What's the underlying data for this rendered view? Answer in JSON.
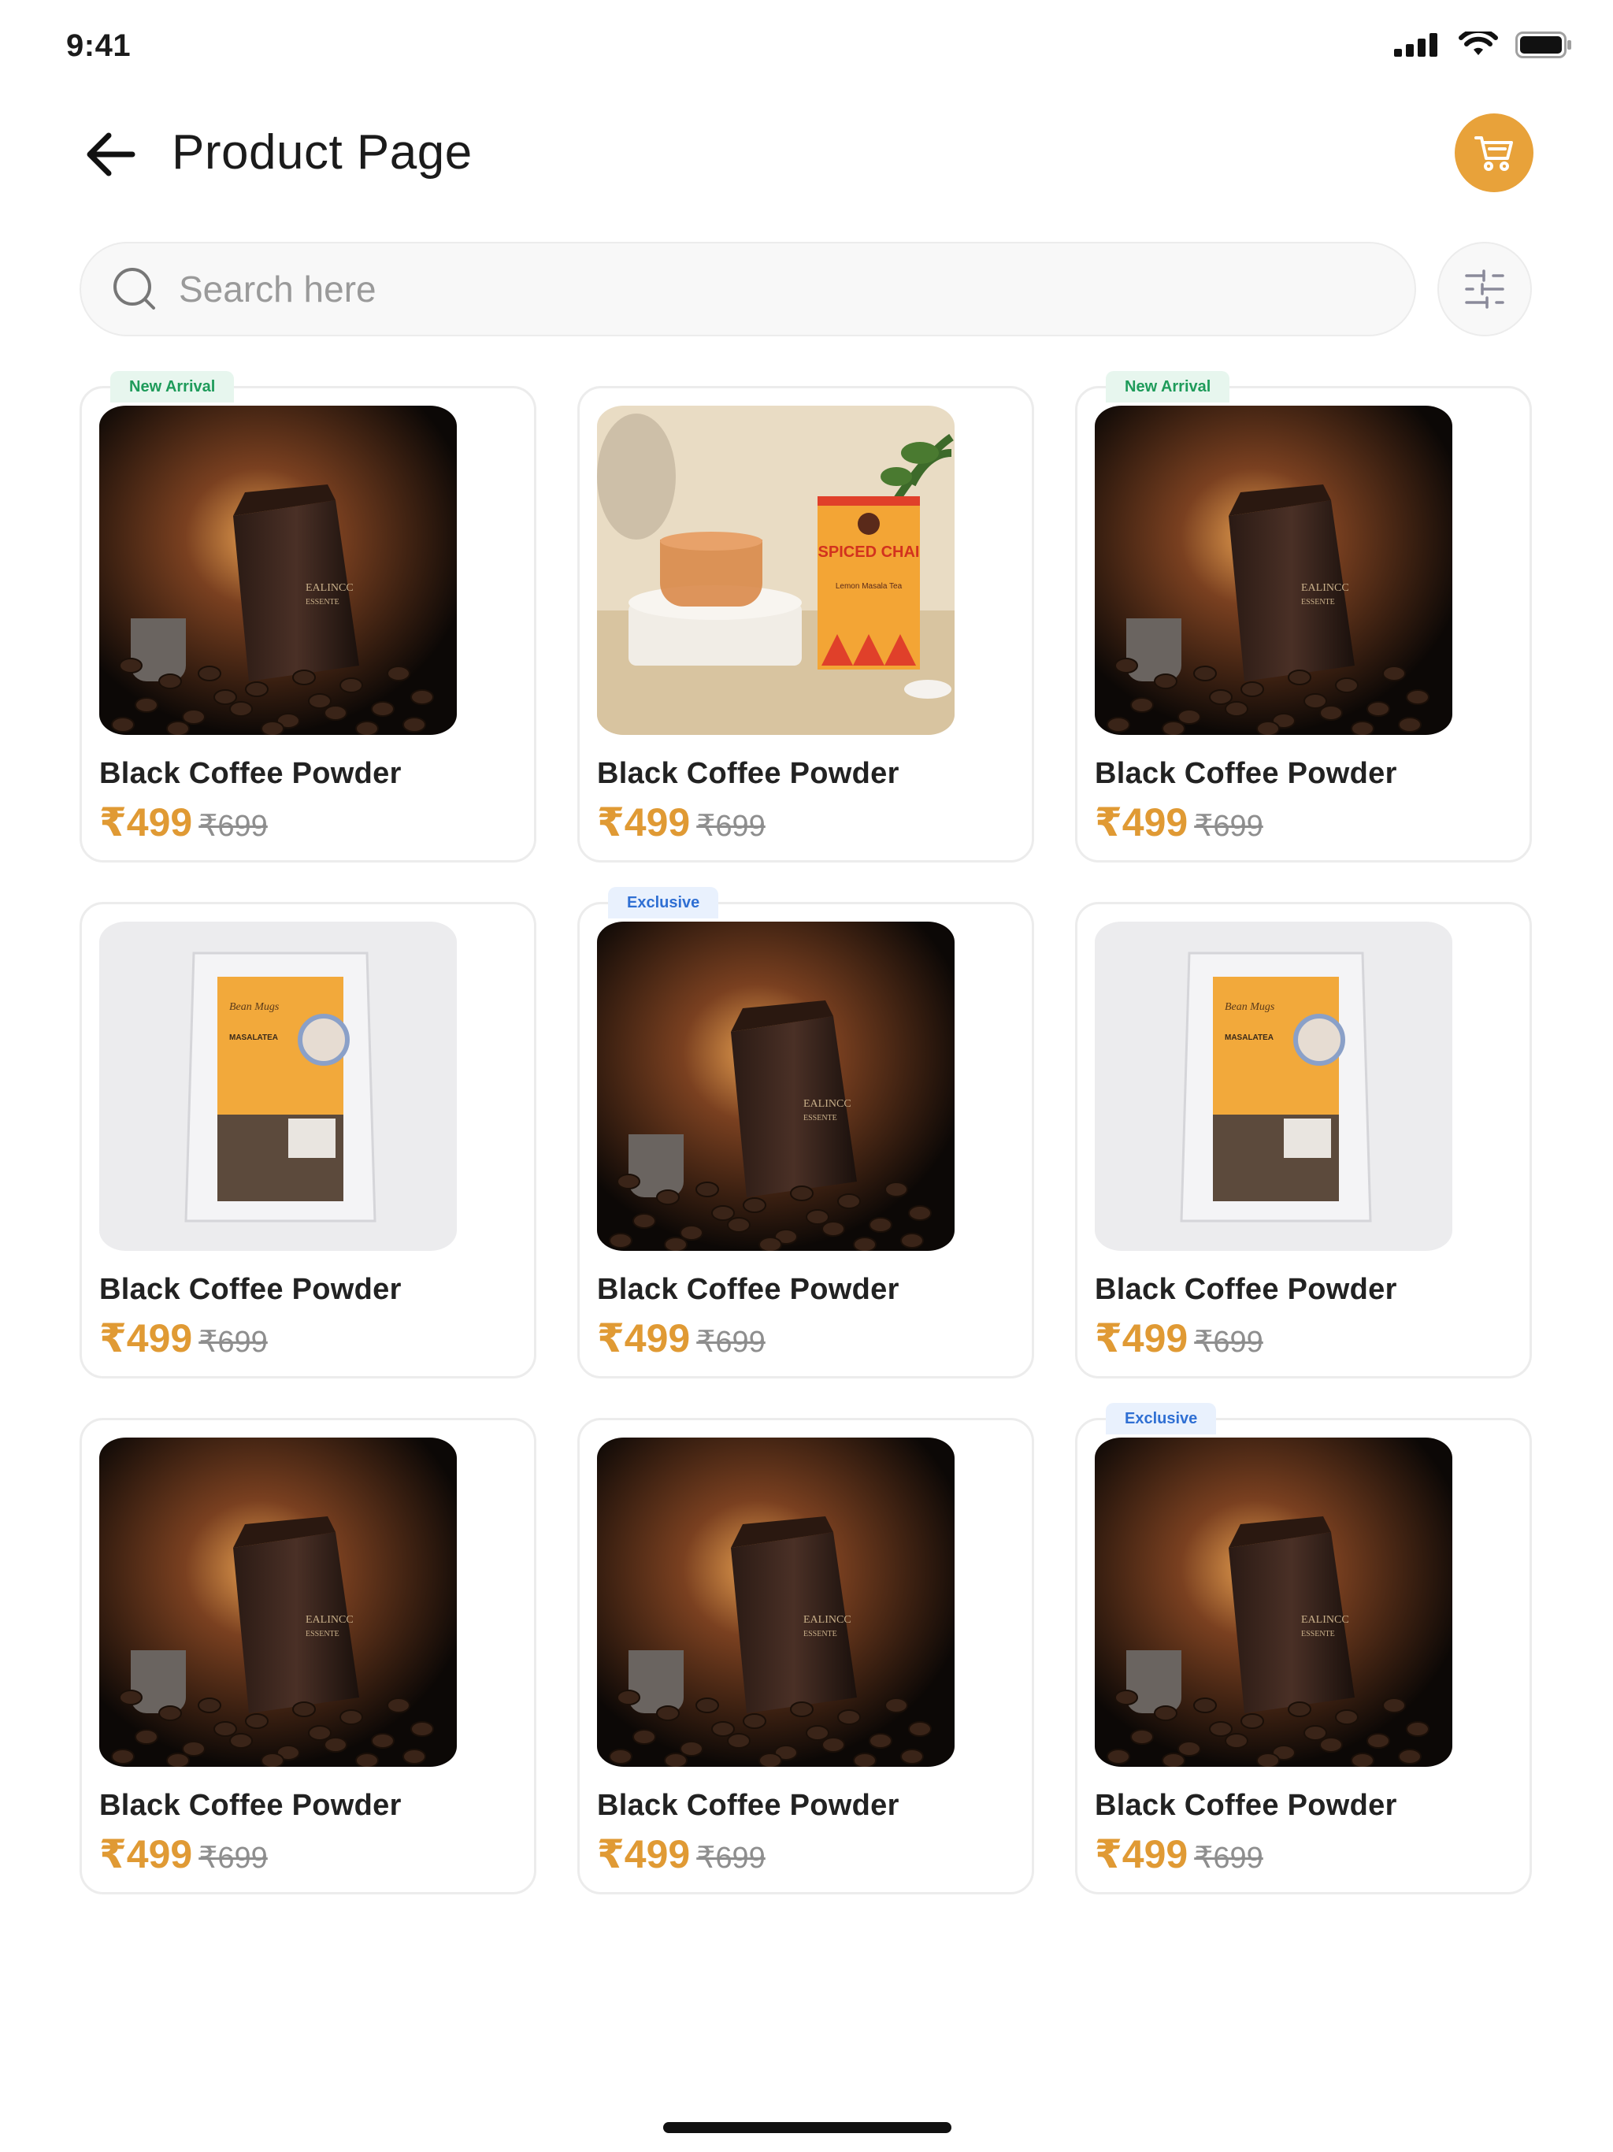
{
  "status_bar": {
    "time": "9:41"
  },
  "header": {
    "title": "Product Page"
  },
  "search": {
    "placeholder": "Search here"
  },
  "colors": {
    "accent": "#e8a23a",
    "price": "#e09a34",
    "new_badge": "#1e9b5a",
    "exclusive_badge": "#2f6fd3"
  },
  "icons": {
    "back": "arrow-left-icon",
    "cart": "cart-icon",
    "search": "search-icon",
    "filter": "sliders-icon"
  },
  "products": [
    {
      "name": "Black Coffee Powder",
      "price": "₹499",
      "old_price": "₹699",
      "badge": "New Arrival",
      "badge_type": "new",
      "image": "coffee"
    },
    {
      "name": "Black Coffee Powder",
      "price": "₹499",
      "old_price": "₹699",
      "badge": "",
      "badge_type": "",
      "image": "chai"
    },
    {
      "name": "Black Coffee Powder",
      "price": "₹499",
      "old_price": "₹699",
      "badge": "New Arrival",
      "badge_type": "new",
      "image": "coffee"
    },
    {
      "name": "Black Coffee Powder",
      "price": "₹499",
      "old_price": "₹699",
      "badge": "",
      "badge_type": "",
      "image": "pouch"
    },
    {
      "name": "Black Coffee Powder",
      "price": "₹499",
      "old_price": "₹699",
      "badge": "Exclusive",
      "badge_type": "excl",
      "image": "coffee"
    },
    {
      "name": "Black Coffee Powder",
      "price": "₹499",
      "old_price": "₹699",
      "badge": "",
      "badge_type": "",
      "image": "pouch"
    },
    {
      "name": "Black Coffee Powder",
      "price": "₹499",
      "old_price": "₹699",
      "badge": "",
      "badge_type": "",
      "image": "coffee"
    },
    {
      "name": "Black Coffee Powder",
      "price": "₹499",
      "old_price": "₹699",
      "badge": "",
      "badge_type": "",
      "image": "coffee"
    },
    {
      "name": "Black Coffee Powder",
      "price": "₹499",
      "old_price": "₹699",
      "badge": "Exclusive",
      "badge_type": "excl",
      "image": "coffee"
    }
  ],
  "product_images": {
    "chai": {
      "box_title": "SPICED CHAI",
      "box_subtitle": "Lemon Masala Tea"
    },
    "pouch": {
      "brand": "Bean Mugs",
      "label": "MASALATEA"
    },
    "coffee": {
      "brand": "EALINCC",
      "label": "ESSENTE"
    }
  }
}
